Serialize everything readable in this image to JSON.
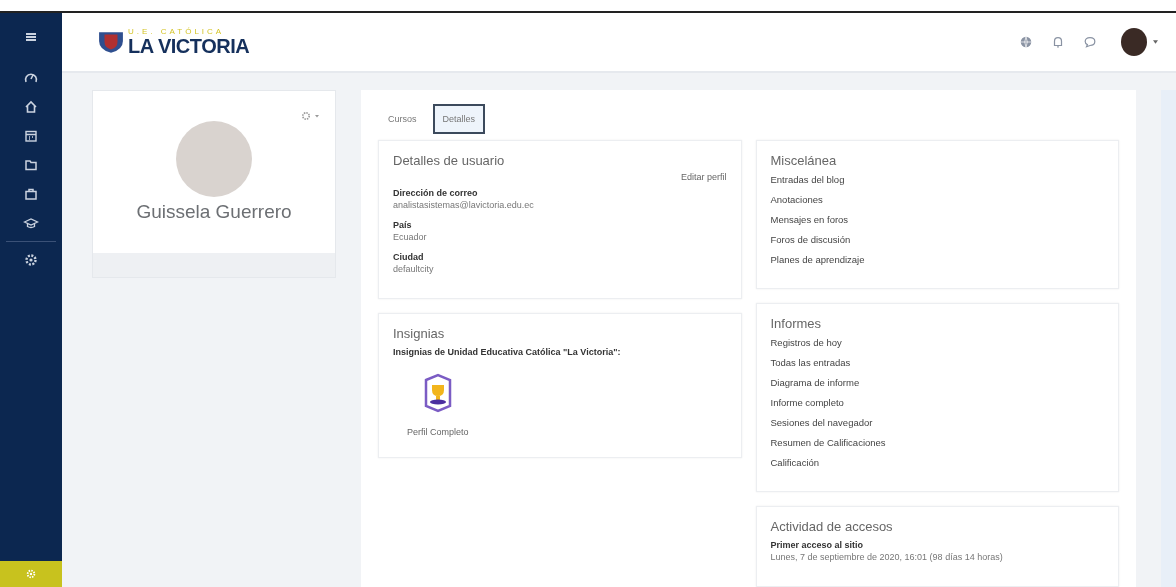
{
  "header": {
    "logo_top": "U.E. CATÓLICA",
    "logo_name": "LA VICTORIA"
  },
  "profile": {
    "name": "Guissela Guerrero"
  },
  "tabs": [
    {
      "label": "Cursos",
      "selected": false
    },
    {
      "label": "Detalles",
      "selected": true
    }
  ],
  "user_details": {
    "title": "Detalles de usuario",
    "edit_link": "Editar perfil",
    "fields": [
      {
        "label": "Dirección de correo",
        "value": "analistasistemas@lavictoria.edu.ec"
      },
      {
        "label": "País",
        "value": "Ecuador"
      },
      {
        "label": "Ciudad",
        "value": "defaultcity"
      }
    ]
  },
  "badges": {
    "title": "Insignias",
    "subtitle": "Insignias de Unidad Educativa Católica \"La Victoria\":",
    "items": [
      {
        "name": "Perfil Completo"
      }
    ]
  },
  "misc": {
    "title": "Miscelánea",
    "links": [
      "Entradas del blog",
      "Anotaciones",
      "Mensajes en foros",
      "Foros de discusión",
      "Planes de aprendizaje"
    ]
  },
  "reports": {
    "title": "Informes",
    "links": [
      "Registros de hoy",
      "Todas las entradas",
      "Diagrama de informe",
      "Informe completo",
      "Sesiones del navegador",
      "Resumen de Calificaciones",
      "Calificación"
    ]
  },
  "access": {
    "title": "Actividad de accesos",
    "fields": [
      {
        "label": "Primer acceso al sitio",
        "value": "Lunes, 7 de septiembre de 2020, 16:01  (98 días 14 horas)"
      }
    ]
  }
}
